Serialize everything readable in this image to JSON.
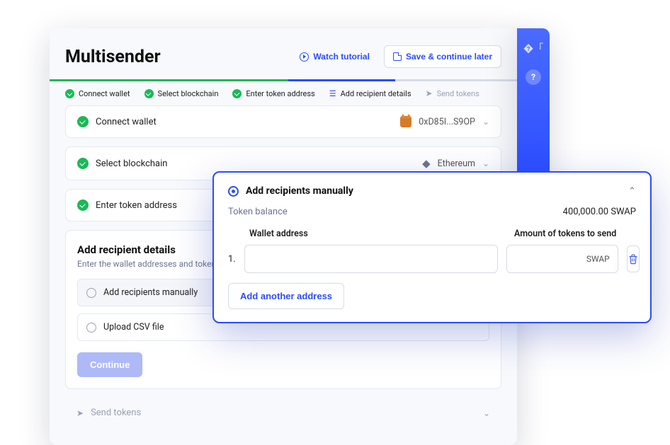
{
  "header": {
    "title": "Multisender",
    "watch_tutorial": "Watch tutorial",
    "save_later": "Save & continue later"
  },
  "stepper": {
    "connect_wallet": "Connect wallet",
    "select_blockchain": "Select blockchain",
    "enter_token": "Enter token address",
    "add_recipients": "Add recipient details",
    "send_tokens": "Send tokens"
  },
  "panels": {
    "connect_wallet": {
      "label": "Connect wallet",
      "value": "0xD85I...S9OP"
    },
    "select_blockchain": {
      "label": "Select blockchain",
      "value": "Ethereum"
    },
    "enter_token": {
      "label": "Enter token address"
    },
    "send_tokens": {
      "label": "Send tokens"
    }
  },
  "details": {
    "title": "Add recipient details",
    "subtitle": "Enter the wallet addresses and token amounts",
    "opt_manual": "Add recipients manually",
    "opt_csv": "Upload CSV file",
    "continue": "Continue"
  },
  "overlay": {
    "title": "Add recipients manually",
    "token_balance_label": "Token balance",
    "token_balance_value": "400,000.00 SWAP",
    "col_wallet": "Wallet address",
    "col_amount": "Amount of tokens to send",
    "row_num": "1.",
    "amount_suffix": "SWAP",
    "add_another": "Add another address"
  },
  "rail": {
    "badge": "?"
  }
}
